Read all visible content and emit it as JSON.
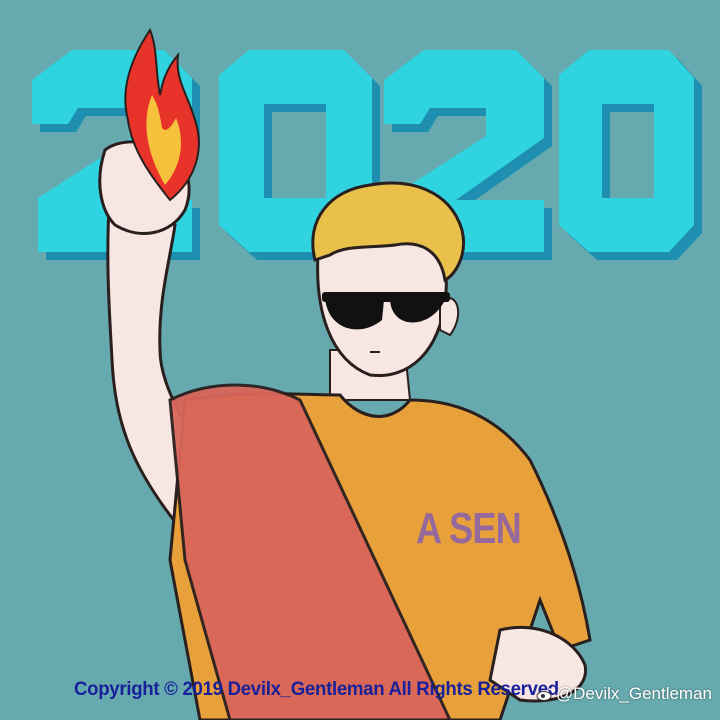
{
  "artwork": {
    "year_text": "2020",
    "shirt_print": "A SEN",
    "copyright": "Copyright © 2019 Devilx_Gentleman All Rights Reserved",
    "watermark": "@Devilx_Gentleman",
    "watermark_icon": "weibo-icon"
  },
  "colors": {
    "background": "#66aaaf",
    "year_face": "#2fd4e0",
    "year_side": "#1e8fb0",
    "hair": "#e8c04a",
    "skin": "#f7e6e2",
    "shirt": "#e8a13a",
    "sash": "#d9665a",
    "flame_outer": "#e8332a",
    "flame_inner": "#f6c23b",
    "copyright_text": "#18209a",
    "shirt_print_text": "#8e63a8"
  }
}
